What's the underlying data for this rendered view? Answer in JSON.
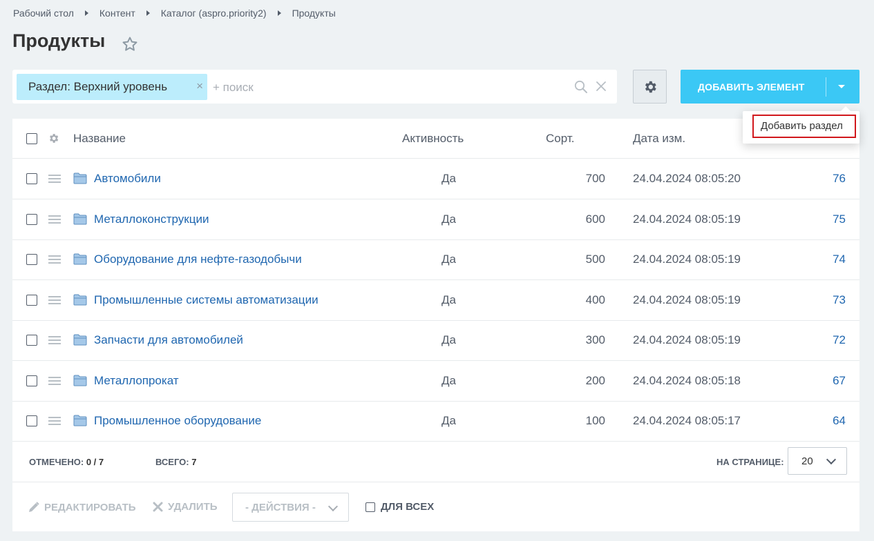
{
  "breadcrumb": [
    "Рабочий стол",
    "Контент",
    "Каталог (aspro.priority2)",
    "Продукты"
  ],
  "page": {
    "title": "Продукты"
  },
  "filter": {
    "tag_label": "Раздел: Верхний уровень",
    "tag_close": "×",
    "search_placeholder": "+ поиск",
    "clear": "✕"
  },
  "toolbar": {
    "add_label": "ДОБАВИТЬ ЭЛЕМЕНТ",
    "dropdown_item": "Добавить раздел"
  },
  "grid": {
    "columns": {
      "name": "Название",
      "active": "Активность",
      "sort": "Сорт.",
      "date": "Дата изм."
    },
    "rows": [
      {
        "name": "Автомобили",
        "active": "Да",
        "sort": "700",
        "date": "24.04.2024 08:05:20",
        "id": "76"
      },
      {
        "name": "Металлоконструкции",
        "active": "Да",
        "sort": "600",
        "date": "24.04.2024 08:05:19",
        "id": "75"
      },
      {
        "name": "Оборудование для нефте-газодобычи",
        "active": "Да",
        "sort": "500",
        "date": "24.04.2024 08:05:19",
        "id": "74"
      },
      {
        "name": "Промышленные системы автоматизации",
        "active": "Да",
        "sort": "400",
        "date": "24.04.2024 08:05:19",
        "id": "73"
      },
      {
        "name": "Запчасти для автомобилей",
        "active": "Да",
        "sort": "300",
        "date": "24.04.2024 08:05:19",
        "id": "72"
      },
      {
        "name": "Металлопрокат",
        "active": "Да",
        "sort": "200",
        "date": "24.04.2024 08:05:18",
        "id": "67"
      },
      {
        "name": "Промышленное оборудование",
        "active": "Да",
        "sort": "100",
        "date": "24.04.2024 08:05:17",
        "id": "64"
      }
    ]
  },
  "footer": {
    "checked_label": "ОТМЕЧЕНО:",
    "checked_value": "0 / 7",
    "total_label": "ВСЕГО:",
    "total_value": "7",
    "per_page_label": "НА СТРАНИЦЕ:",
    "per_page_value": "20"
  },
  "actions": {
    "edit": "РЕДАКТИРОВАТЬ",
    "delete": "УДАЛИТЬ",
    "select": "- ДЕЙСТВИЯ -",
    "for_all": "ДЛЯ ВСЕХ"
  },
  "colors": {
    "accent": "#3bc8f5",
    "link": "#2067b0",
    "tag_bg": "#bcedfc",
    "highlight": "#d1171c"
  }
}
